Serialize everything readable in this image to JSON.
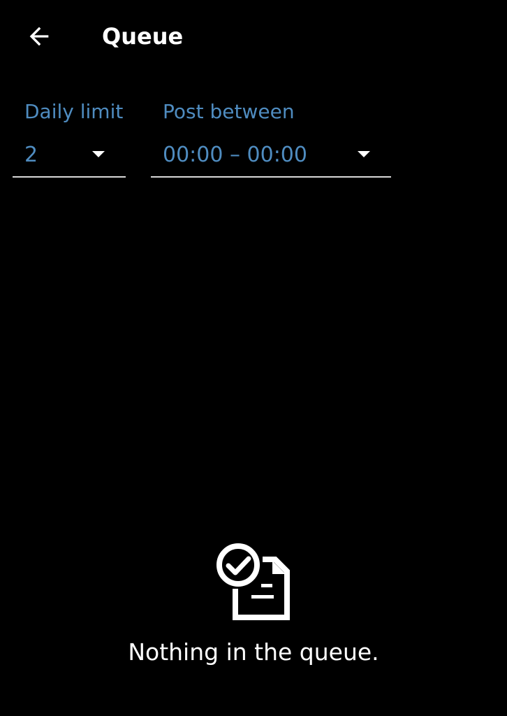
{
  "header": {
    "back_icon": "arrow-left-icon",
    "title": "Queue"
  },
  "settings": {
    "daily_limit": {
      "label": "Daily limit",
      "value": "2",
      "icon": "caret-down-icon"
    },
    "post_between": {
      "label": "Post between",
      "value": "00:00 – 00:00",
      "icon": "caret-down-icon"
    }
  },
  "empty_state": {
    "icon": "queue-empty-icon",
    "message": "Nothing in the queue."
  },
  "colors": {
    "background": "#000000",
    "accent_text": "#4f8cc0",
    "primary_text": "#ffffff",
    "underline": "#d8d8d8"
  }
}
